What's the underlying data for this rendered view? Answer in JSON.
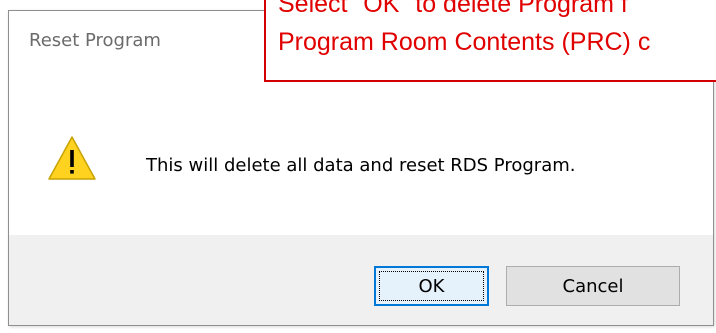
{
  "dialog": {
    "title": "Reset Program",
    "message": "This will delete all data and reset RDS Program.",
    "icon": "warning-icon",
    "buttons": {
      "ok_label": "OK",
      "cancel_label": "Cancel"
    }
  },
  "callout": {
    "line1": "Select \"OK\" to delete Program f",
    "line2": "Program Room Contents (PRC) c"
  },
  "colors": {
    "callout_red": "#e00000",
    "accent_blue": "#0078d7",
    "warning_yellow": "#ffd21f",
    "footer_gray": "#f0f0f0"
  }
}
